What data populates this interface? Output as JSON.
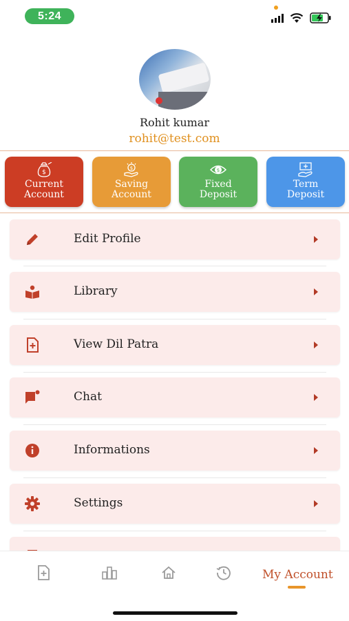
{
  "status": {
    "time": "5:24",
    "icons": [
      "signal-icon",
      "wifi-icon",
      "battery-charging-icon"
    ]
  },
  "profile": {
    "name": "Rohit kumar",
    "email": "rohit@test.com"
  },
  "accounts": [
    {
      "line1": "Current",
      "line2": "Account",
      "icon": "money-bag-icon",
      "color": "#cc3d24"
    },
    {
      "line1": "Saving",
      "line2": "Account",
      "icon": "coin-hand-icon",
      "color": "#e79b37"
    },
    {
      "line1": "Fixed",
      "line2": "Deposit",
      "icon": "eye-coin-icon",
      "color": "#5bb25c"
    },
    {
      "line1": "Term",
      "line2": "Deposit",
      "icon": "deposit-hand-icon",
      "color": "#4d96e8"
    }
  ],
  "menu": [
    {
      "label": "Edit Profile",
      "icon": "pencil-icon"
    },
    {
      "label": "Library",
      "icon": "book-icon"
    },
    {
      "label": "View Dil Patra",
      "icon": "document-plus-icon"
    },
    {
      "label": "Chat",
      "icon": "chat-flag-icon"
    },
    {
      "label": "Informations",
      "icon": "info-icon"
    },
    {
      "label": "Settings",
      "icon": "gear-icon"
    }
  ],
  "bottom_nav": {
    "items": [
      "document-plus-icon",
      "chart-icon",
      "home-icon",
      "history-icon"
    ],
    "active_label": "My Account"
  },
  "colors": {
    "accent": "#c0502a",
    "email": "#e0901e",
    "menu_bg": "#fcebea",
    "icon": "#c0402a"
  }
}
